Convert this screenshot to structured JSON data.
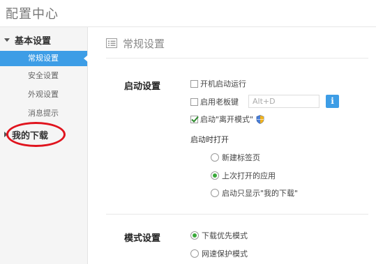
{
  "app": {
    "title": "配置中心"
  },
  "sidebar": {
    "group_label": "基本设置",
    "items": [
      {
        "label": "常规设置",
        "active": true
      },
      {
        "label": "安全设置",
        "active": false
      },
      {
        "label": "外观设置",
        "active": false
      },
      {
        "label": "消息提示",
        "active": false
      }
    ],
    "downloads_label": "我的下载"
  },
  "content": {
    "header_title": "常规设置",
    "startup": {
      "title": "启动设置",
      "auto_start_label": "开机启动运行",
      "auto_start_checked": false,
      "boss_key_label": "启用老板键",
      "boss_key_checked": false,
      "boss_key_value": "Alt+D",
      "info_button_label": "i",
      "leave_mode_label": "启动\"离开模式\"",
      "leave_mode_checked": true,
      "open_on_start_label": "启动时打开",
      "open_options": [
        {
          "label": "新建标签页",
          "selected": false
        },
        {
          "label": "上次打开的应用",
          "selected": true
        },
        {
          "label": "启动只显示\"我的下载\"",
          "selected": false
        }
      ]
    },
    "mode": {
      "title": "模式设置",
      "options": [
        {
          "label": "下载优先模式",
          "selected": true
        },
        {
          "label": "网速保护模式",
          "selected": false
        }
      ]
    }
  },
  "colors": {
    "accent": "#3d9de6",
    "highlight_circle": "#e0141e",
    "radio_selected": "#3aa93a",
    "checkmark": "#2c8a2c"
  },
  "icons": {
    "header": "list-icon",
    "group_toggle": "triangle-down-icon",
    "downloads_toggle": "triangle-right-icon",
    "leave_mode": "shield-icon",
    "info": "info-icon"
  }
}
